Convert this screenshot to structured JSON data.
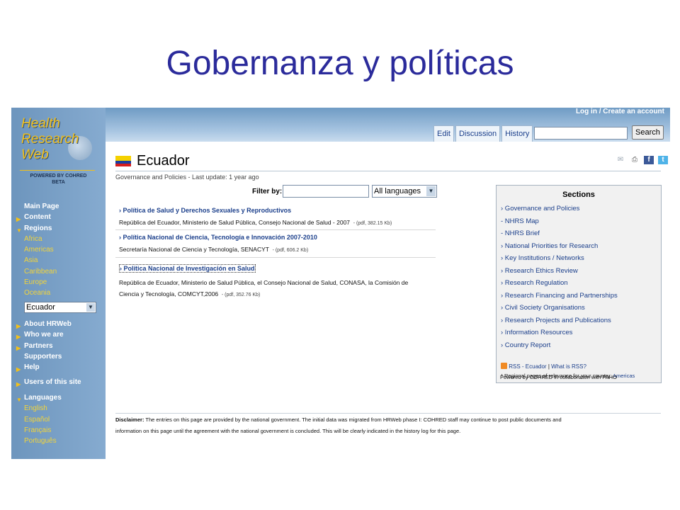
{
  "slide": {
    "title": "Gobernanza y políticas"
  },
  "topbar": {
    "login": "Log in",
    "separator": " / ",
    "create_account": "Create an account",
    "tabs": [
      "Edit",
      "Discussion",
      "History"
    ],
    "search_button": "Search"
  },
  "logo": {
    "line1": "Health",
    "line2": "Research",
    "line3": "Web",
    "powered": "POWERED BY COHRED",
    "beta": "BETA"
  },
  "sidebar": {
    "items": [
      {
        "label": "Main Page",
        "type": "plain"
      },
      {
        "label": "Content",
        "type": "arrow"
      },
      {
        "label": "Regions",
        "type": "open"
      },
      {
        "label": "Africa",
        "type": "sub"
      },
      {
        "label": "Americas",
        "type": "sub"
      },
      {
        "label": "Asia",
        "type": "sub"
      },
      {
        "label": "Caribbean",
        "type": "sub"
      },
      {
        "label": "Europe",
        "type": "sub"
      },
      {
        "label": "Oceania",
        "type": "sub"
      }
    ],
    "country_select": "Ecuador",
    "items2": [
      {
        "label": "About HRWeb",
        "type": "arrow"
      },
      {
        "label": "Who we are",
        "type": "arrow"
      },
      {
        "label": "Partners",
        "type": "arrow"
      },
      {
        "label": "Supporters",
        "type": "plain"
      },
      {
        "label": "Help",
        "type": "arrow"
      }
    ],
    "users": "Users of this site",
    "languages_header": "Languages",
    "languages": [
      "English",
      "Español",
      "Français",
      "Português"
    ]
  },
  "main": {
    "country": "Ecuador",
    "subtitle": "Governance and Policies - Last update: 1 year ago",
    "filter_label": "Filter by:",
    "language_select": "All languages",
    "icons": [
      "email-icon",
      "print-icon",
      "facebook-icon",
      "twitter-icon"
    ],
    "documents": [
      {
        "title": "› Política de Salud y Derechos Sexuales y Reproductivos",
        "lines": [
          "República del Ecuador, Ministerio de Salud Pública, Consejo Nacional de Salud - 2007"
        ],
        "meta": "- (pdf, 382.15 Kb)"
      },
      {
        "title": "› Política Nacional de Ciencia, Tecnología e Innovación 2007-2010",
        "lines": [
          "Secretaría Nacional de Ciencia y Tecnología, SENACYT"
        ],
        "meta": "- (pdf, 606.2 Kb)"
      },
      {
        "title": "› Política Nacional de Investigación en Salud",
        "lines": [
          "República de Ecuador, Ministerio de Salud Pública, el Consejo Nacional de Salud, CONASA, la Comisión de",
          "Ciencia y Tecnología, COMCYT,2006"
        ],
        "meta": "- (pdf, 352.76 Kb)"
      }
    ]
  },
  "sections": {
    "title": "Sections",
    "items": [
      "› Governance and Policies",
      " - NHRS Map",
      " - NHRS Brief",
      "› National Priorities for Research",
      "› Key Institutions / Networks",
      "› Research Ethics Review",
      "› Research Regulation",
      "› Research Financing and Partnerships",
      "› Civil Society Organisations",
      "› Research Projects and Publications",
      "› Information Resources",
      "› Country Report"
    ],
    "rss": "RSS - Ecuador",
    "rss_sep": " | ",
    "rss_what": "What is RSS?",
    "note1_prefix": "* Regional pages of relevance for your country: ",
    "note1_link": "Americas",
    "note2": "Powered by COHRED in collaboration with PAHO"
  },
  "disclaimer": {
    "label": "Disclaimer:",
    "line1": " The entries on this page are provided by the national government. The initial data was migrated from HRWeb phase I: COHRED staff may continue to post public documents and",
    "line2": "information on this page until the agreement with the national government is concluded. This will be clearly indicated in the history log for this page."
  }
}
